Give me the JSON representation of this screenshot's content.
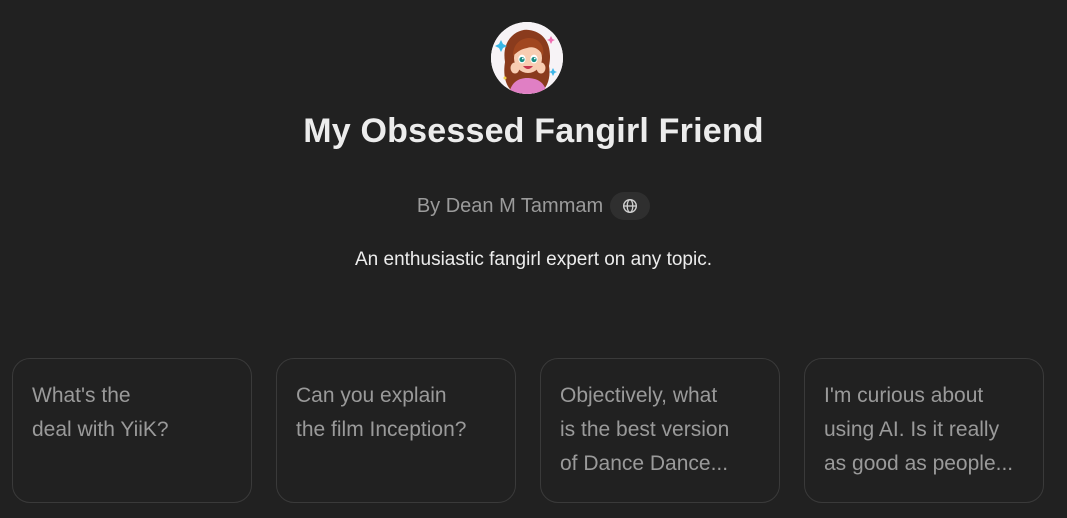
{
  "gpt": {
    "avatar_icon": "fangirl-cartoon-avatar",
    "title": "My Obsessed Fangirl Friend",
    "author": "By Dean M Tammam",
    "globe_icon": "globe-icon",
    "description": "An enthusiastic fangirl expert on any topic."
  },
  "starters": [
    {
      "line1": "What's the",
      "line2": "deal with YiiK?",
      "line3": ""
    },
    {
      "line1": "Can you explain",
      "line2": "the film Inception?",
      "line3": ""
    },
    {
      "line1": "Objectively, what",
      "line2": "is the best version",
      "line3": "of Dance Dance..."
    },
    {
      "line1": "I'm curious about",
      "line2": "using AI. Is it really",
      "line3": "as good as people..."
    }
  ],
  "colors": {
    "background": "#212121",
    "text_primary": "#ececec",
    "text_secondary": "#9b9b9b",
    "card_border": "#3a3a3a"
  }
}
